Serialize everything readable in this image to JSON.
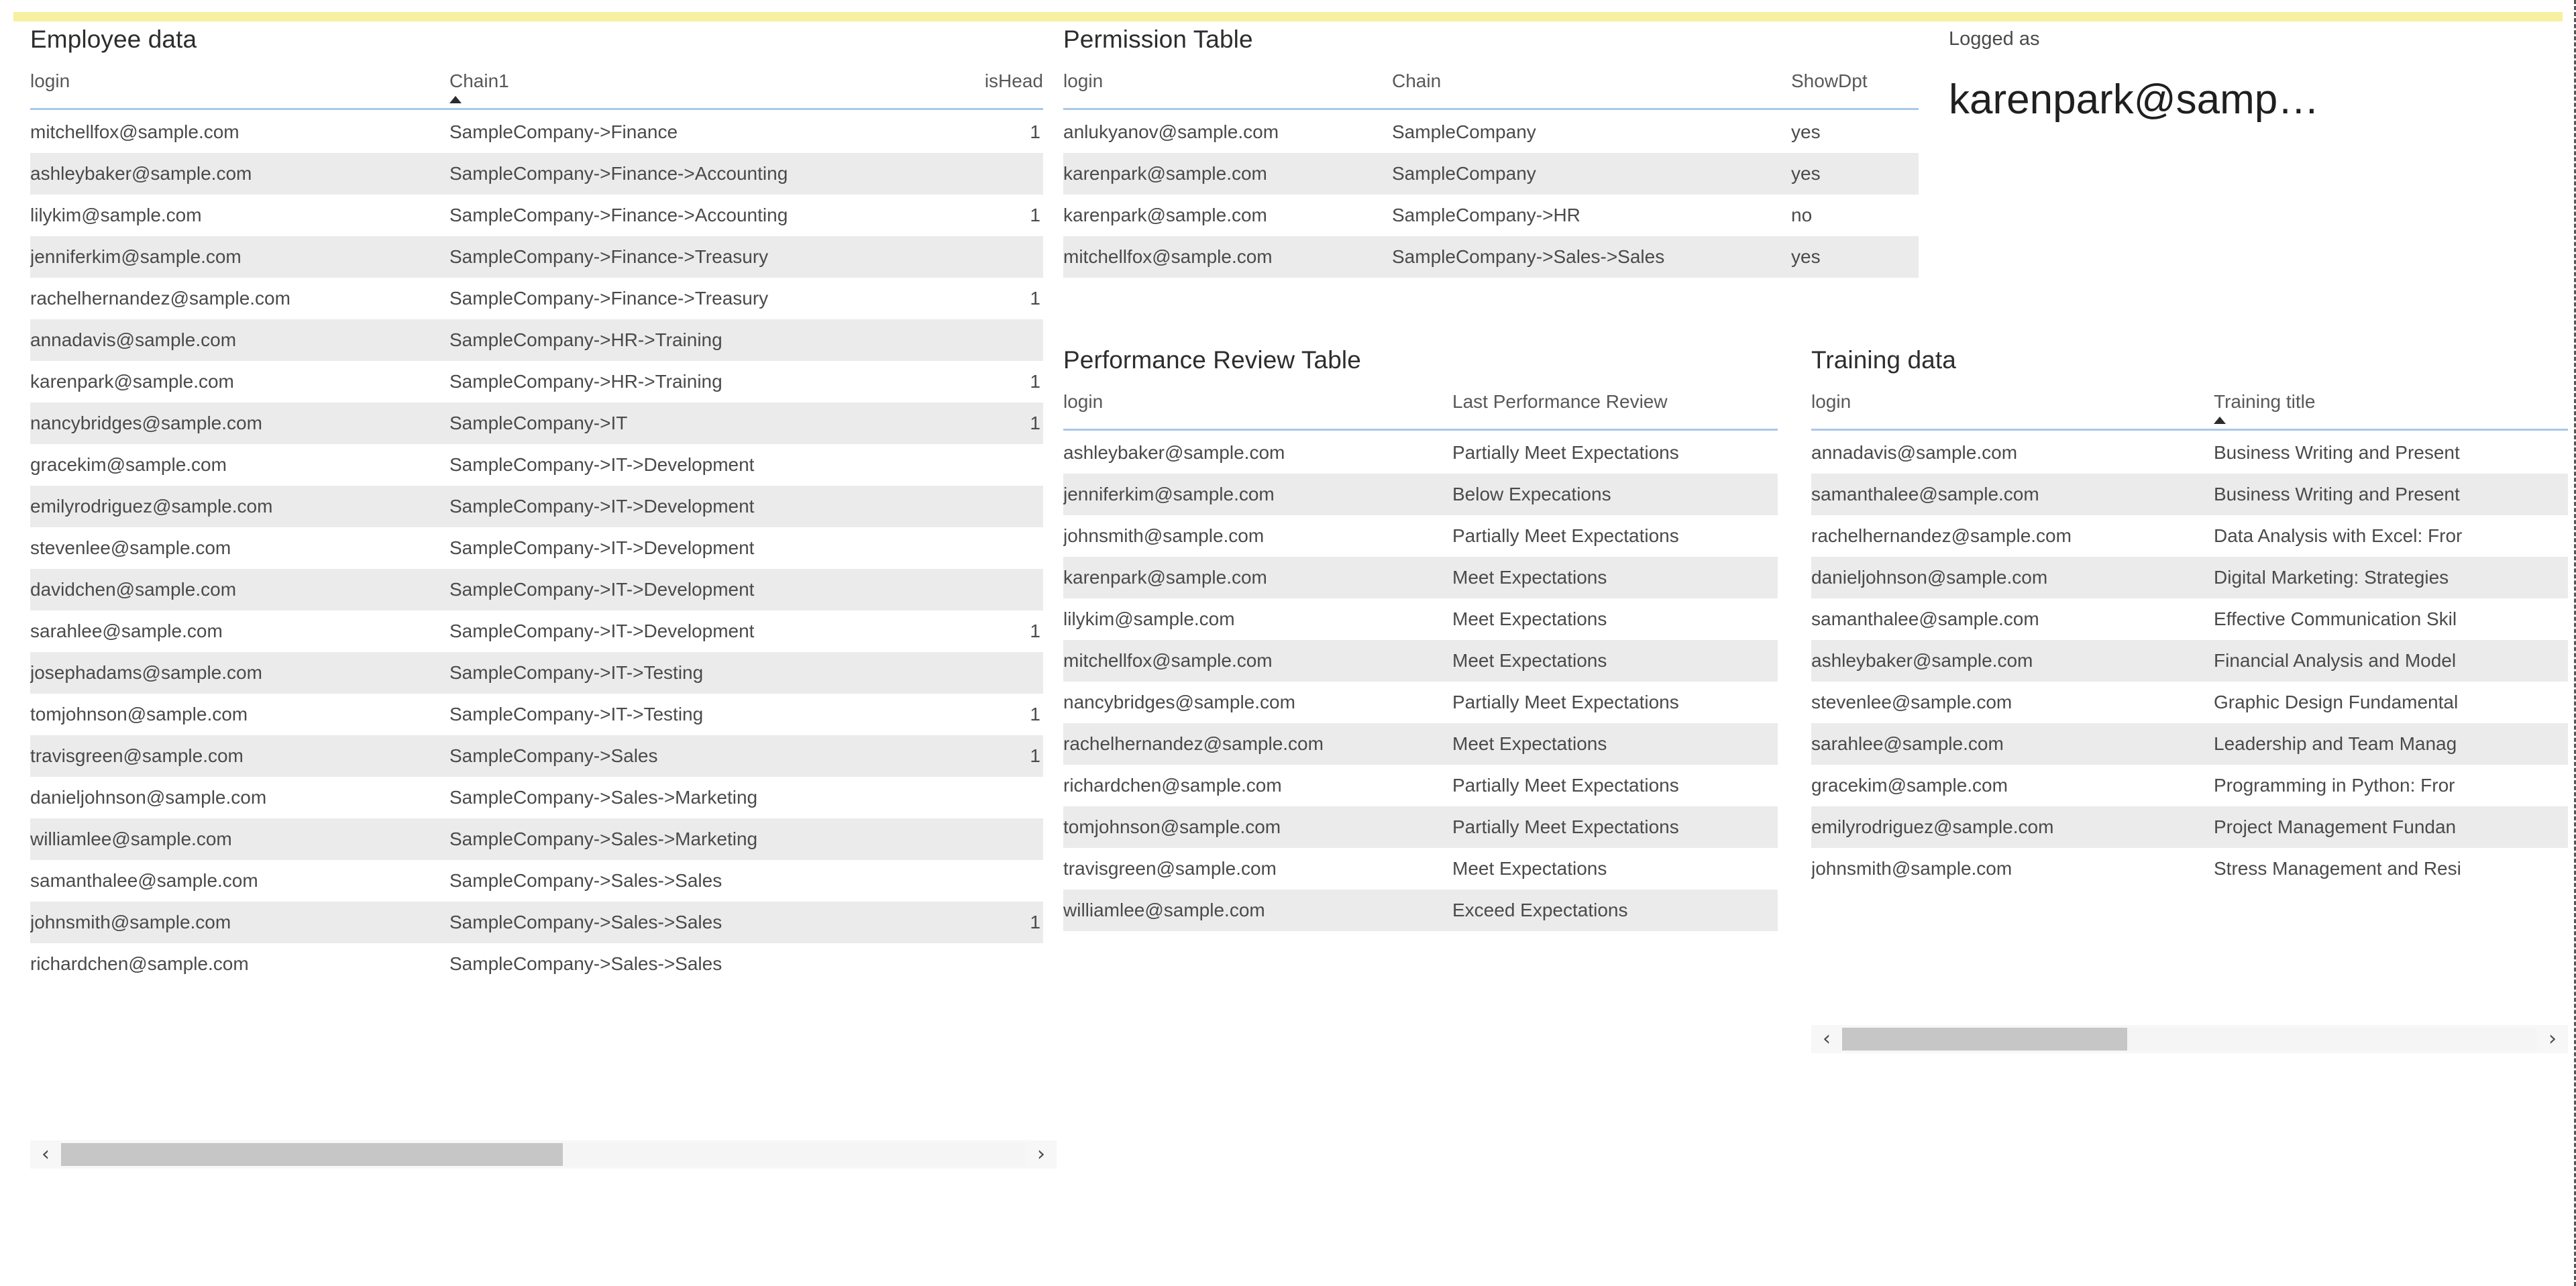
{
  "theme": {
    "accent_bar": "#f7f0a0",
    "header_rule": "#a9c8e8",
    "row_band": "#ebebeb",
    "scroll_thumb": "#c6c6c6",
    "text": "#4a4a4a"
  },
  "employee": {
    "title": "Employee data",
    "columns": [
      "login",
      "Chain1",
      "isHead"
    ],
    "sorted_column": "Chain1",
    "sort_direction": "asc",
    "rows": [
      {
        "login": "mitchellfox@sample.com",
        "chain": "SampleCompany->Finance",
        "isHead": "1"
      },
      {
        "login": "ashleybaker@sample.com",
        "chain": "SampleCompany->Finance->Accounting",
        "isHead": ""
      },
      {
        "login": "lilykim@sample.com",
        "chain": "SampleCompany->Finance->Accounting",
        "isHead": "1"
      },
      {
        "login": "jenniferkim@sample.com",
        "chain": "SampleCompany->Finance->Treasury",
        "isHead": ""
      },
      {
        "login": "rachelhernandez@sample.com",
        "chain": "SampleCompany->Finance->Treasury",
        "isHead": "1"
      },
      {
        "login": "annadavis@sample.com",
        "chain": "SampleCompany->HR->Training",
        "isHead": ""
      },
      {
        "login": "karenpark@sample.com",
        "chain": "SampleCompany->HR->Training",
        "isHead": "1"
      },
      {
        "login": "nancybridges@sample.com",
        "chain": "SampleCompany->IT",
        "isHead": "1"
      },
      {
        "login": "gracekim@sample.com",
        "chain": "SampleCompany->IT->Development",
        "isHead": ""
      },
      {
        "login": "emilyrodriguez@sample.com",
        "chain": "SampleCompany->IT->Development",
        "isHead": ""
      },
      {
        "login": "stevenlee@sample.com",
        "chain": "SampleCompany->IT->Development",
        "isHead": ""
      },
      {
        "login": "davidchen@sample.com",
        "chain": "SampleCompany->IT->Development",
        "isHead": ""
      },
      {
        "login": "sarahlee@sample.com",
        "chain": "SampleCompany->IT->Development",
        "isHead": "1"
      },
      {
        "login": "josephadams@sample.com",
        "chain": "SampleCompany->IT->Testing",
        "isHead": ""
      },
      {
        "login": "tomjohnson@sample.com",
        "chain": "SampleCompany->IT->Testing",
        "isHead": "1"
      },
      {
        "login": "travisgreen@sample.com",
        "chain": "SampleCompany->Sales",
        "isHead": "1"
      },
      {
        "login": "danieljohnson@sample.com",
        "chain": "SampleCompany->Sales->Marketing",
        "isHead": ""
      },
      {
        "login": "williamlee@sample.com",
        "chain": "SampleCompany->Sales->Marketing",
        "isHead": ""
      },
      {
        "login": "samanthalee@sample.com",
        "chain": "SampleCompany->Sales->Sales",
        "isHead": ""
      },
      {
        "login": "johnsmith@sample.com",
        "chain": "SampleCompany->Sales->Sales",
        "isHead": "1"
      },
      {
        "login": "richardchen@sample.com",
        "chain": "SampleCompany->Sales->Sales",
        "isHead": ""
      }
    ]
  },
  "permission": {
    "title": "Permission Table",
    "columns": [
      "login",
      "Chain",
      "ShowDpt"
    ],
    "rows": [
      {
        "login": "anlukyanov@sample.com",
        "chain": "SampleCompany",
        "showdpt": "yes"
      },
      {
        "login": "karenpark@sample.com",
        "chain": "SampleCompany",
        "showdpt": "yes"
      },
      {
        "login": "karenpark@sample.com",
        "chain": "SampleCompany->HR",
        "showdpt": "no"
      },
      {
        "login": "mitchellfox@sample.com",
        "chain": "SampleCompany->Sales->Sales",
        "showdpt": "yes"
      }
    ]
  },
  "performance": {
    "title": "Performance Review Table",
    "columns": [
      "login",
      "Last Performance Review"
    ],
    "rows": [
      {
        "login": "ashleybaker@sample.com",
        "review": "Partially Meet Expectations"
      },
      {
        "login": "jenniferkim@sample.com",
        "review": "Below Expecations"
      },
      {
        "login": "johnsmith@sample.com",
        "review": "Partially Meet Expectations"
      },
      {
        "login": "karenpark@sample.com",
        "review": "Meet Expectations"
      },
      {
        "login": "lilykim@sample.com",
        "review": "Meet Expectations"
      },
      {
        "login": "mitchellfox@sample.com",
        "review": "Meet Expectations"
      },
      {
        "login": "nancybridges@sample.com",
        "review": "Partially Meet Expectations"
      },
      {
        "login": "rachelhernandez@sample.com",
        "review": "Meet Expectations"
      },
      {
        "login": "richardchen@sample.com",
        "review": "Partially Meet Expectations"
      },
      {
        "login": "tomjohnson@sample.com",
        "review": "Partially Meet Expectations"
      },
      {
        "login": "travisgreen@sample.com",
        "review": "Meet Expectations"
      },
      {
        "login": "williamlee@sample.com",
        "review": "Exceed Expectations"
      }
    ]
  },
  "training": {
    "title": "Training data",
    "columns": [
      "login",
      "Training title"
    ],
    "sorted_column": "Training title",
    "sort_direction": "asc",
    "rows": [
      {
        "login": "annadavis@sample.com",
        "title": "Business Writing and Present"
      },
      {
        "login": "samanthalee@sample.com",
        "title": "Business Writing and Present"
      },
      {
        "login": "rachelhernandez@sample.com",
        "title": "Data Analysis with Excel: Fror"
      },
      {
        "login": "danieljohnson@sample.com",
        "title": "Digital Marketing: Strategies"
      },
      {
        "login": "samanthalee@sample.com",
        "title": "Effective Communication Skil"
      },
      {
        "login": "ashleybaker@sample.com",
        "title": "Financial Analysis and Model"
      },
      {
        "login": "stevenlee@sample.com",
        "title": "Graphic Design Fundamental"
      },
      {
        "login": "sarahlee@sample.com",
        "title": "Leadership and Team Manag"
      },
      {
        "login": "gracekim@sample.com",
        "title": "Programming in Python: Fror"
      },
      {
        "login": "emilyrodriguez@sample.com",
        "title": "Project Management Fundan"
      },
      {
        "login": "johnsmith@sample.com",
        "title": "Stress Management and Resi"
      }
    ]
  },
  "logged_as": {
    "label": "Logged as",
    "value": "karenpark@samp…"
  },
  "scrollbars": {
    "left_arrow": "‹",
    "right_arrow": "›"
  }
}
